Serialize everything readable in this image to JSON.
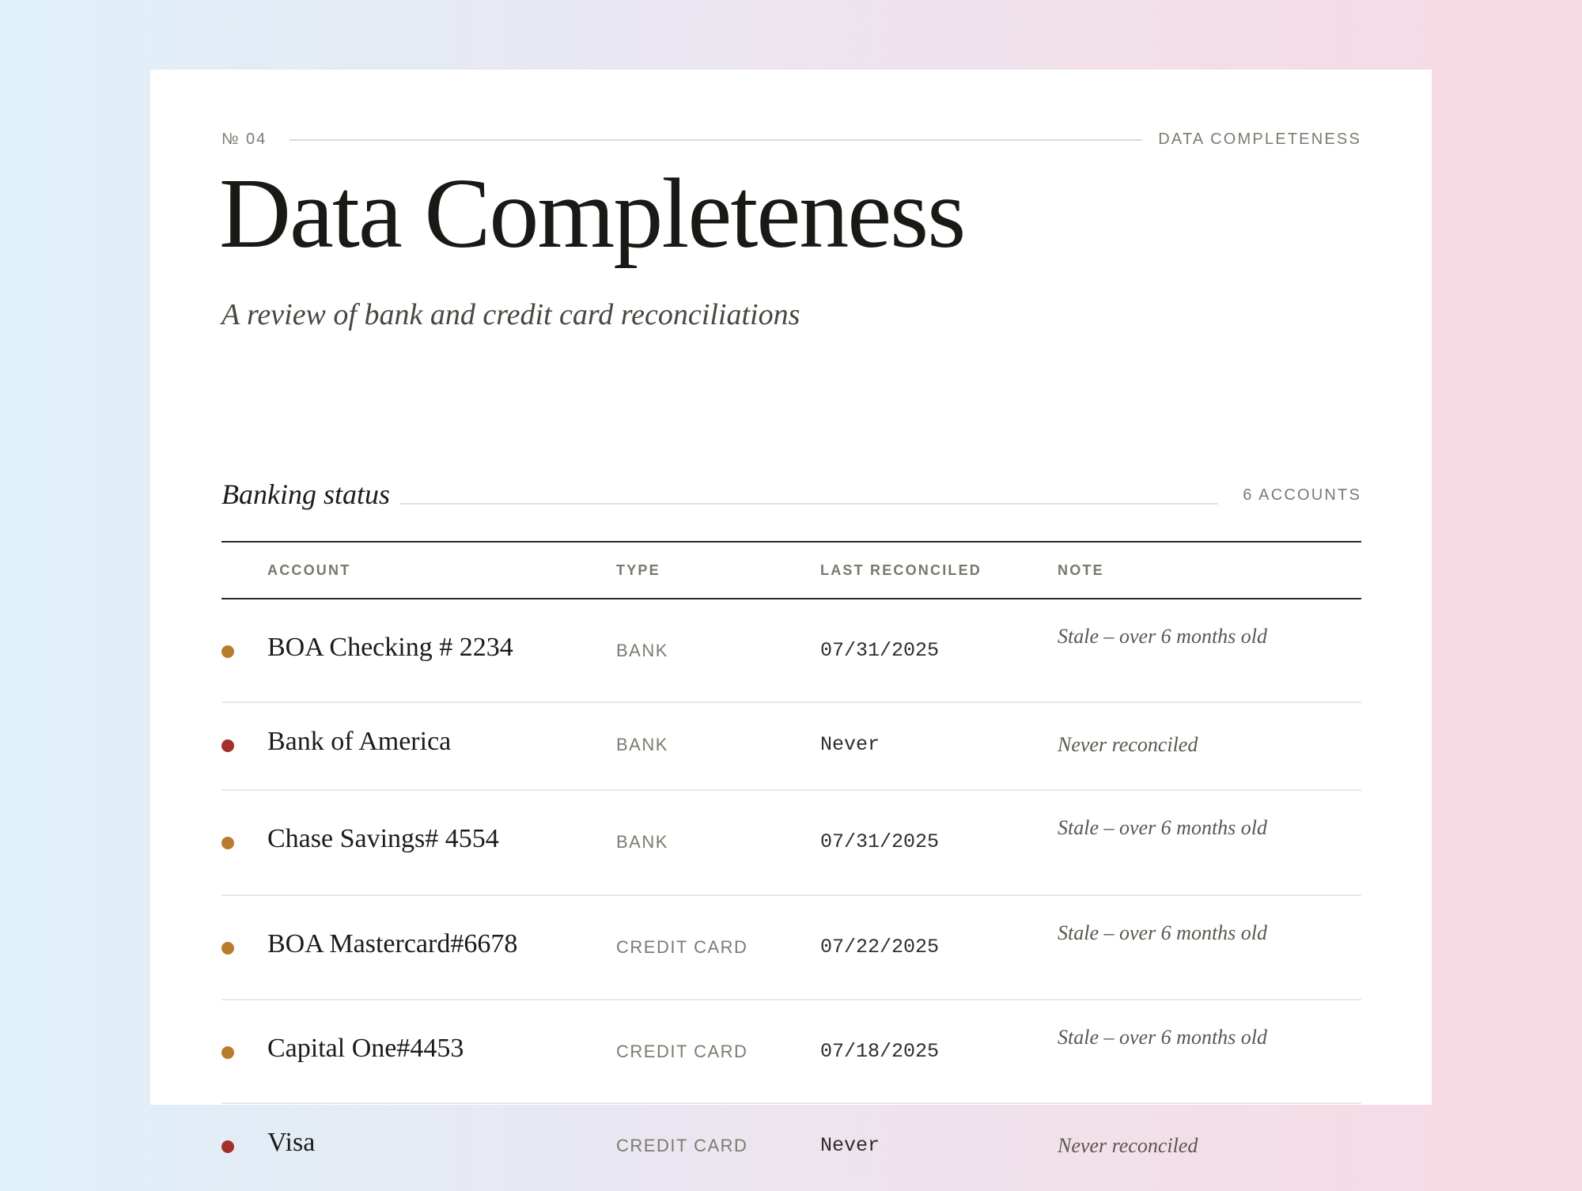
{
  "meta": {
    "number": "№ 04",
    "label": "DATA COMPLETENESS"
  },
  "page": {
    "title": "Data Completeness",
    "subtitle": "A review of bank and credit card reconciliations"
  },
  "section": {
    "title": "Banking status",
    "count": "6 ACCOUNTS"
  },
  "table": {
    "headers": {
      "account": "ACCOUNT",
      "type": "TYPE",
      "last_reconciled": "LAST RECONCILED",
      "note": "NOTE"
    },
    "rows": [
      {
        "status": "stale",
        "account": "BOA Checking # 2234",
        "type": "BANK",
        "last_reconciled": "07/31/2025",
        "note": "Stale – over 6 months old"
      },
      {
        "status": "never",
        "account": "Bank of America",
        "type": "BANK",
        "last_reconciled": "Never",
        "note": "Never reconciled"
      },
      {
        "status": "stale",
        "account": "Chase Savings# 4554",
        "type": "BANK",
        "last_reconciled": "07/31/2025",
        "note": "Stale – over 6 months old"
      },
      {
        "status": "stale",
        "account": "BOA Mastercard#6678",
        "type": "CREDIT CARD",
        "last_reconciled": "07/22/2025",
        "note": "Stale – over 6 months old"
      },
      {
        "status": "stale",
        "account": "Capital One#4453",
        "type": "CREDIT CARD",
        "last_reconciled": "07/18/2025",
        "note": "Stale – over 6 months old"
      },
      {
        "status": "never",
        "account": "Visa",
        "type": "CREDIT CARD",
        "last_reconciled": "Never",
        "note": "Never reconciled"
      }
    ]
  },
  "colors": {
    "stale": "#b77d2c",
    "never": "#a3302a"
  }
}
